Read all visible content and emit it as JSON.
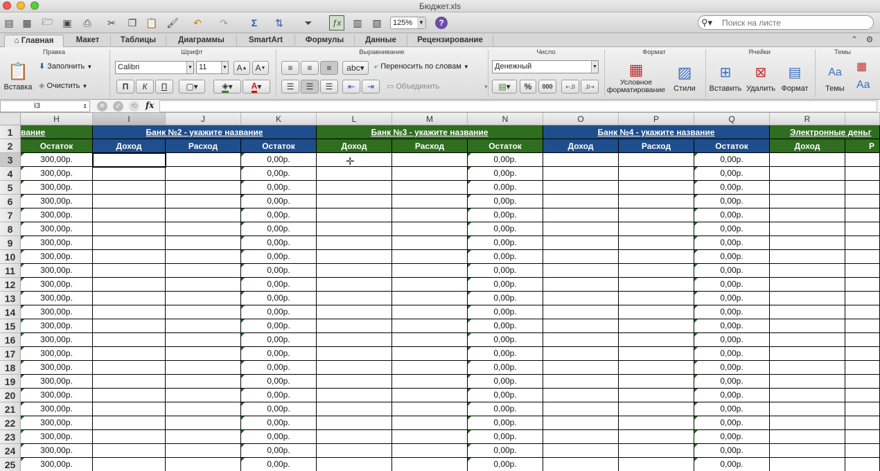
{
  "window": {
    "title": "Бюджет.xls",
    "zoom": "125%",
    "search_placeholder": "Поиск на листе"
  },
  "ribbon_tabs": [
    "Главная",
    "Макет",
    "Таблицы",
    "Диаграммы",
    "SmartArt",
    "Формулы",
    "Данные",
    "Рецензирование"
  ],
  "ribbon": {
    "groups": {
      "edit": "Правка",
      "font": "Шрифт",
      "align": "Выравнивание",
      "number": "Число",
      "format": "Формат",
      "cells": "Ячейки",
      "themes": "Темы"
    },
    "paste": "Вставка",
    "fill": "Заполнить",
    "clear": "Очистить",
    "font_name": "Calibri",
    "font_size": "11",
    "bold": "П",
    "italic": "К",
    "underline": "П",
    "abc": "abc",
    "wrap": "Переносить по словам",
    "merge": "Объединить",
    "number_format": "Денежный",
    "percent": "%",
    "thousands": "000",
    "cond_format_1": "Условное",
    "cond_format_2": "форматирование",
    "styles": "Стили",
    "insert": "Вставить",
    "delete": "Удалить",
    "format": "Формат",
    "themes": "Темы",
    "aa": "Aa"
  },
  "formula_bar": {
    "cell_ref": "I3",
    "fx": "fx",
    "value": ""
  },
  "columns": [
    "H",
    "I",
    "J",
    "K",
    "L",
    "M",
    "N",
    "O",
    "P",
    "Q",
    "R"
  ],
  "banks": {
    "prev_tail": "вание",
    "bank2": "Банк №2 - укажите название",
    "bank3": "Банк №3 - укажите название",
    "bank4": "Банк №4 - укажите название",
    "emoney": "Электронные деньг"
  },
  "subheaders": {
    "income": "Доход",
    "expense": "Расход",
    "balance": "Остаток",
    "r_tail": "Р"
  },
  "rows": [
    "1",
    "2",
    "3",
    "4",
    "5",
    "6",
    "7",
    "8",
    "9",
    "10",
    "11",
    "12",
    "13",
    "14",
    "15",
    "16",
    "17",
    "18",
    "19",
    "20",
    "21",
    "22",
    "23",
    "24",
    "25"
  ],
  "values": {
    "h_balance": "300,00р.",
    "zero_balance": "0,00р."
  }
}
